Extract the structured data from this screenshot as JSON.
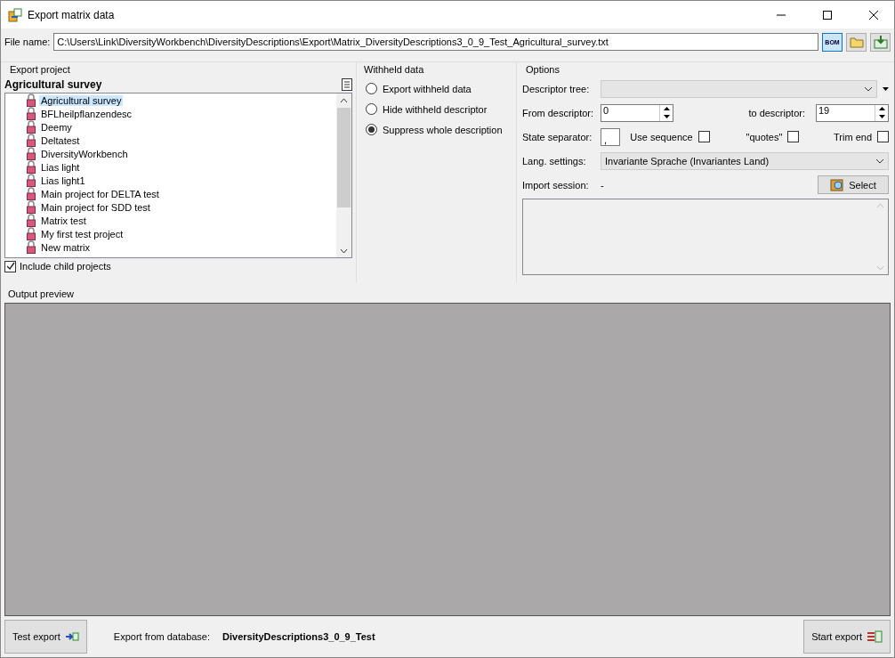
{
  "window": {
    "title": "Export matrix data"
  },
  "file": {
    "label": "File name:",
    "value": "C:\\Users\\Link\\DiversityWorkbench\\DiversityDescriptions\\Export\\Matrix_DiversityDescriptions3_0_9_Test_Agricultural_survey.txt",
    "bom_label": "BOM"
  },
  "export_project": {
    "title": "Export project",
    "current": "Agricultural survey",
    "items": [
      {
        "label": "Agricultural survey",
        "selected": true
      },
      {
        "label": "BFLheilpflanzendesc",
        "selected": false
      },
      {
        "label": "Deemy",
        "selected": false
      },
      {
        "label": "Deltatest",
        "selected": false
      },
      {
        "label": "DiversityWorkbench",
        "selected": false
      },
      {
        "label": "Lias light",
        "selected": false
      },
      {
        "label": "Lias light1",
        "selected": false
      },
      {
        "label": "Main project for DELTA test",
        "selected": false
      },
      {
        "label": "Main project for SDD test",
        "selected": false
      },
      {
        "label": "Matrix test",
        "selected": false
      },
      {
        "label": "My first test project",
        "selected": false
      },
      {
        "label": "New matrix",
        "selected": false
      }
    ],
    "include_child": {
      "label": "Include child projects",
      "checked": true
    }
  },
  "withheld": {
    "title": "Withheld data",
    "options": [
      {
        "label": "Export withheld data",
        "selected": false
      },
      {
        "label": "Hide withheld descriptor",
        "selected": false
      },
      {
        "label": "Suppress whole description",
        "selected": true
      }
    ]
  },
  "options": {
    "title": "Options",
    "descriptor_tree_label": "Descriptor tree:",
    "from_label": "From descriptor:",
    "from_value": "0",
    "to_label": "to descriptor:",
    "to_value": "19",
    "separator_label": "State separator:",
    "separator_value": ",",
    "checks": [
      {
        "label": "Use sequence",
        "checked": false
      },
      {
        "label": "\"quotes\"",
        "checked": false
      },
      {
        "label": "Trim end",
        "checked": false
      }
    ],
    "lang_label": "Lang. settings:",
    "lang_value": "Invariante Sprache (Invariantes Land)",
    "session_label": "Import session:",
    "session_value": "-",
    "select_label": "Select"
  },
  "preview": {
    "title": "Output preview"
  },
  "bottom": {
    "test_label": "Test export",
    "db_label": "Export from database:",
    "db_value": "DiversityDescriptions3_0_9_Test",
    "start_label": "Start export"
  }
}
